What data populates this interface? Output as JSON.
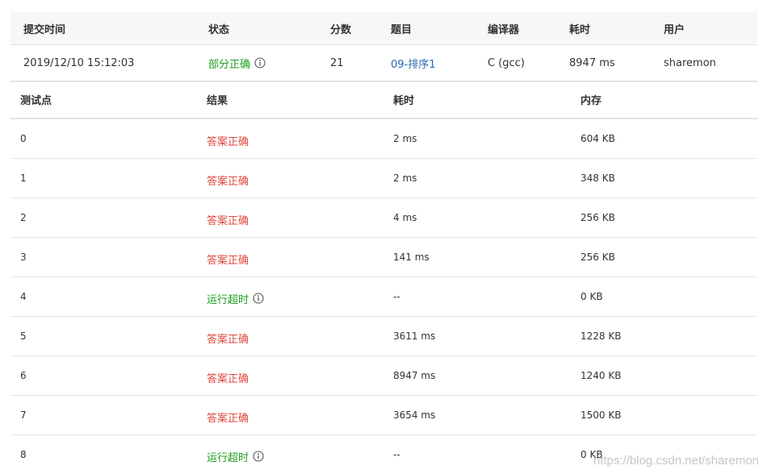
{
  "colors": {
    "accepted": "#1a9e1a",
    "wrong": "#e0473b",
    "link": "#2668b4",
    "header_bg": "#f7f7f7",
    "border": "#e4e4e4"
  },
  "summary": {
    "headers": {
      "time": "提交时间",
      "status": "状态",
      "score": "分数",
      "problem": "题目",
      "compiler": "编译器",
      "duration": "耗时",
      "user": "用户"
    },
    "row": {
      "time": "2019/12/10 15:12:03",
      "status": "部分正确",
      "status_icon": "info-icon",
      "score": "21",
      "problem": "09-排序1",
      "compiler": "C (gcc)",
      "duration": "8947 ms",
      "user": "sharemon"
    }
  },
  "cases": {
    "headers": {
      "point": "测试点",
      "result": "结果",
      "duration": "耗时",
      "memory": "内存"
    },
    "rows": [
      {
        "point": "0",
        "result": "答案正确",
        "status": "wrong-color",
        "duration": "2 ms",
        "memory": "604 KB"
      },
      {
        "point": "1",
        "result": "答案正确",
        "status": "wrong-color",
        "duration": "2 ms",
        "memory": "348 KB"
      },
      {
        "point": "2",
        "result": "答案正确",
        "status": "wrong-color",
        "duration": "4 ms",
        "memory": "256 KB"
      },
      {
        "point": "3",
        "result": "答案正确",
        "status": "wrong-color",
        "duration": "141 ms",
        "memory": "256 KB"
      },
      {
        "point": "4",
        "result": "运行超时",
        "status": "accepted-color",
        "icon": "info-icon",
        "duration": "--",
        "memory": "0 KB"
      },
      {
        "point": "5",
        "result": "答案正确",
        "status": "wrong-color",
        "duration": "3611 ms",
        "memory": "1228 KB"
      },
      {
        "point": "6",
        "result": "答案正确",
        "status": "wrong-color",
        "duration": "8947 ms",
        "memory": "1240 KB"
      },
      {
        "point": "7",
        "result": "答案正确",
        "status": "wrong-color",
        "duration": "3654 ms",
        "memory": "1500 KB"
      },
      {
        "point": "8",
        "result": "运行超时",
        "status": "accepted-color",
        "icon": "info-icon",
        "duration": "--",
        "memory": "0 KB"
      }
    ]
  },
  "watermark": "https://blog.csdn.net/sharemon"
}
